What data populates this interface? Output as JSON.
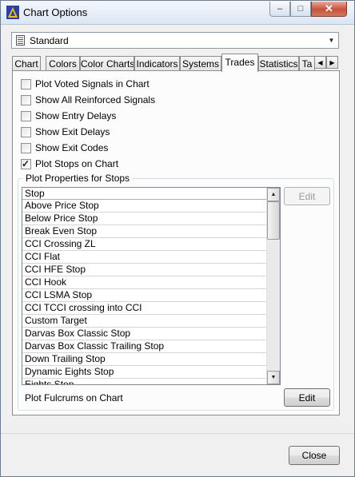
{
  "window": {
    "title": "Chart Options",
    "controls": {
      "minimize": "–",
      "maximize": "□",
      "close": "✕"
    }
  },
  "profile_select": {
    "value": "Standard"
  },
  "tabs": [
    {
      "label": "Chart",
      "active": false
    },
    {
      "label": "Colors",
      "active": false
    },
    {
      "label": "Color Charts",
      "active": false
    },
    {
      "label": "Indicators",
      "active": false
    },
    {
      "label": "Systems",
      "active": false
    },
    {
      "label": "Trades",
      "active": true
    },
    {
      "label": "Statistics",
      "active": false
    },
    {
      "label": "Ta",
      "active": false
    }
  ],
  "tab_scroll": {
    "left": "◀",
    "right": "▶"
  },
  "options": [
    {
      "label": "Plot Voted Signals in Chart",
      "checked": false
    },
    {
      "label": "Show All Reinforced Signals",
      "checked": false
    },
    {
      "label": "Show Entry Delays",
      "checked": false
    },
    {
      "label": "Show Exit Delays",
      "checked": false
    },
    {
      "label": "Show Exit Codes",
      "checked": false
    },
    {
      "label": "Plot Stops on Chart",
      "checked": true
    }
  ],
  "stops_group": {
    "title": "Plot Properties for Stops",
    "column_header": "Stop",
    "items": [
      "Above Price Stop",
      "Below Price Stop",
      "Break Even Stop",
      "CCI Crossing ZL",
      "CCI Flat",
      "CCI HFE Stop",
      "CCI Hook",
      "CCI LSMA Stop",
      "CCI TCCI crossing into CCI",
      "Custom Target",
      "Darvas Box Classic Stop",
      "Darvas Box Classic Trailing Stop",
      "Down Trailing Stop",
      "Dynamic Eights Stop",
      "Eights Stop"
    ],
    "edit_stop_button": "Edit",
    "fulcrums_label": "Plot Fulcrums on Chart",
    "edit_fulcrums_button": "Edit"
  },
  "scrollbar": {
    "up": "▲",
    "down": "▼"
  },
  "close_button": "Close",
  "colors": {
    "title_bar": "#dbe6f4",
    "close_caption": "#c6513a",
    "tab_border": "#8c8c8c"
  }
}
